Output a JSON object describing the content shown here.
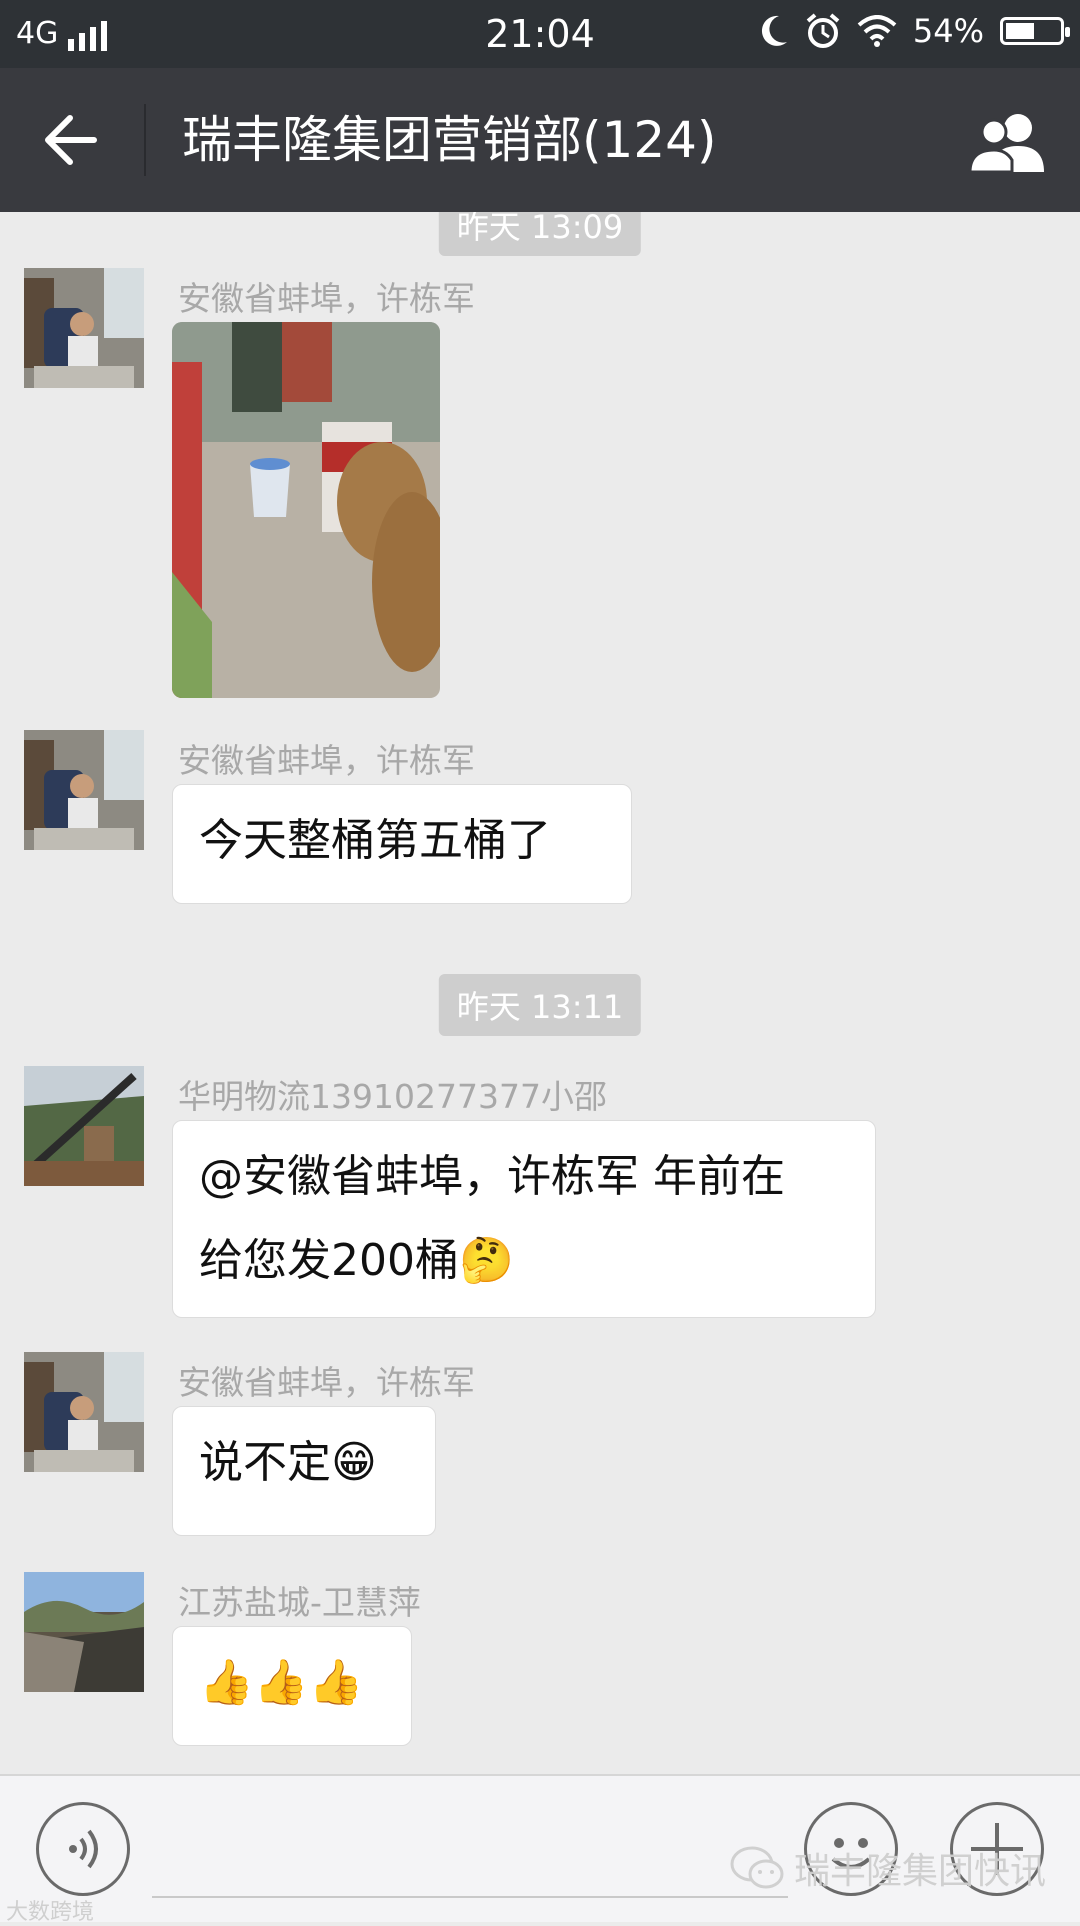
{
  "status_bar": {
    "network": "4G",
    "time": "21:04",
    "battery": "54%",
    "battery_level": 0.54,
    "icons": [
      "signal-icon",
      "moon-icon",
      "alarm-icon",
      "wifi-icon",
      "battery-icon"
    ]
  },
  "header": {
    "title": "瑞丰隆集团营销部(124)",
    "back_icon": "back-arrow-icon",
    "members_icon": "group-members-icon"
  },
  "chat": {
    "top_partial_timestamp": "昨天 13:09",
    "timestamp": "昨天 13:11",
    "messages": [
      {
        "sender": "安徽省蚌埠，许栋军",
        "type": "image"
      },
      {
        "sender": "安徽省蚌埠，许栋军",
        "text": "今天整桶第五桶了"
      },
      {
        "sender": "华明物流13910277377小邵",
        "line1": "@安徽省蚌埠，许栋军 年前在",
        "line2": "给您发200桶",
        "emoji": "🤔"
      },
      {
        "sender": "安徽省蚌埠，许栋军",
        "text": "说不定",
        "emoji": "😁"
      },
      {
        "sender": "江苏盐城-卫慧萍",
        "emoji": "👍👍👍"
      }
    ]
  },
  "input_bar": {
    "voice_icon": "voice-icon",
    "emoji_icon": "emoji-icon",
    "plus_icon": "plus-icon"
  },
  "watermark": {
    "text": "瑞丰隆集团快讯",
    "corner_text": "大数跨境"
  },
  "colors": {
    "title_bar": "#393a3f",
    "status_bar": "#2e3236",
    "chat_bg": "#ebebeb",
    "bubble": "#ffffff"
  }
}
